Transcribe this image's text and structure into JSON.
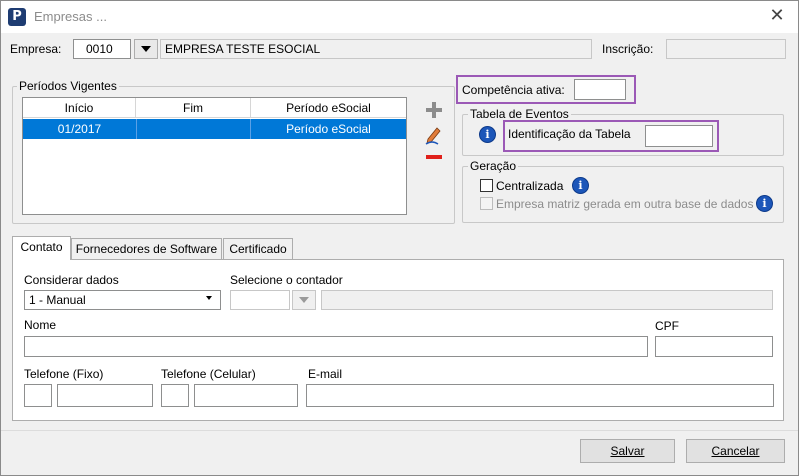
{
  "window": {
    "title": "Empresas ...",
    "app_icon": "P"
  },
  "empresa": {
    "label": "Empresa:",
    "code": "0010",
    "name": "EMPRESA TESTE ESOCIAL",
    "inscricao_label": "Inscrição:",
    "inscricao_value": ""
  },
  "periodos": {
    "legend": "Períodos Vigentes",
    "columns": [
      "Início",
      "Fim",
      "Período eSocial"
    ],
    "rows": [
      {
        "inicio": "01/2017",
        "fim": "",
        "periodo": "Período eSocial"
      }
    ]
  },
  "competencia": {
    "label": "Competência ativa:",
    "value": ""
  },
  "tabela_eventos": {
    "legend": "Tabela de Eventos",
    "label": "Identificação da Tabela",
    "value": ""
  },
  "geracao": {
    "legend": "Geração",
    "centralizada": "Centralizada",
    "matriz": "Empresa matriz gerada em outra base de dados"
  },
  "tabs": [
    "Contato",
    "Fornecedores de Software",
    "Certificado"
  ],
  "contato": {
    "considerar_label": "Considerar dados",
    "considerar_value": "1 - Manual",
    "contador_label": "Selecione o contador",
    "nome_label": "Nome",
    "cpf_label": "CPF",
    "tel_fixo_label": "Telefone (Fixo)",
    "tel_celular_label": "Telefone (Celular)",
    "email_label": "E-mail"
  },
  "buttons": {
    "salvar": "Salvar",
    "cancelar": "Cancelar"
  },
  "colors": {
    "selection": "#0078d7",
    "highlight": "#9b59b6",
    "info": "#1c56b9",
    "add": "#8c8c8c",
    "remove": "#e0201b"
  }
}
